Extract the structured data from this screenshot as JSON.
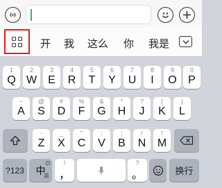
{
  "candidates": [
    "开",
    "我",
    "这么",
    "你",
    "我是"
  ],
  "keyboard": {
    "row1": [
      {
        "label": "Q",
        "hint": "1"
      },
      {
        "label": "W",
        "hint": "2"
      },
      {
        "label": "E",
        "hint": "3"
      },
      {
        "label": "R",
        "hint": "4"
      },
      {
        "label": "T",
        "hint": "5"
      },
      {
        "label": "Y",
        "hint": "6"
      },
      {
        "label": "U",
        "hint": "7"
      },
      {
        "label": "I",
        "hint": "8"
      },
      {
        "label": "O",
        "hint": "9"
      },
      {
        "label": "P",
        "hint": "0"
      }
    ],
    "row2": [
      {
        "label": "A",
        "hint": "~"
      },
      {
        "label": "S",
        "hint": "@"
      },
      {
        "label": "D",
        "hint": "#"
      },
      {
        "label": "F",
        "hint": "%"
      },
      {
        "label": "G",
        "hint": "&"
      },
      {
        "label": "H",
        "hint": "*"
      },
      {
        "label": "J",
        "hint": "?"
      },
      {
        "label": "K",
        "hint": "("
      },
      {
        "label": "L",
        "hint": ")"
      }
    ],
    "row3": [
      {
        "label": "Z",
        "hint": "-"
      },
      {
        "label": "X",
        "hint": "_"
      },
      {
        "label": "C",
        "hint": "\""
      },
      {
        "label": "V",
        "hint": ":"
      },
      {
        "label": "B",
        "hint": ";"
      },
      {
        "label": "N",
        "hint": "/"
      },
      {
        "label": "M",
        "hint": "!"
      }
    ],
    "numbers_label": "?123",
    "lang_label": "中",
    "lang_sub": "英",
    "comma_label": "，",
    "comma_hint": "!",
    "period_label": "。",
    "period_hint": "?",
    "enter_label": "换行"
  },
  "icons": {
    "voice": "voice-icon",
    "emoji": "emoji-icon",
    "plus": "plus-icon",
    "menu": "grid-menu-icon",
    "collapse": "collapse-keyboard-icon",
    "shift": "shift-icon",
    "backspace": "backspace-icon",
    "mic": "microphone-icon",
    "emoji_key": "emoji-key-icon"
  },
  "colors": {
    "highlight": "#e01f1f",
    "cursor": "#2fbf43"
  }
}
